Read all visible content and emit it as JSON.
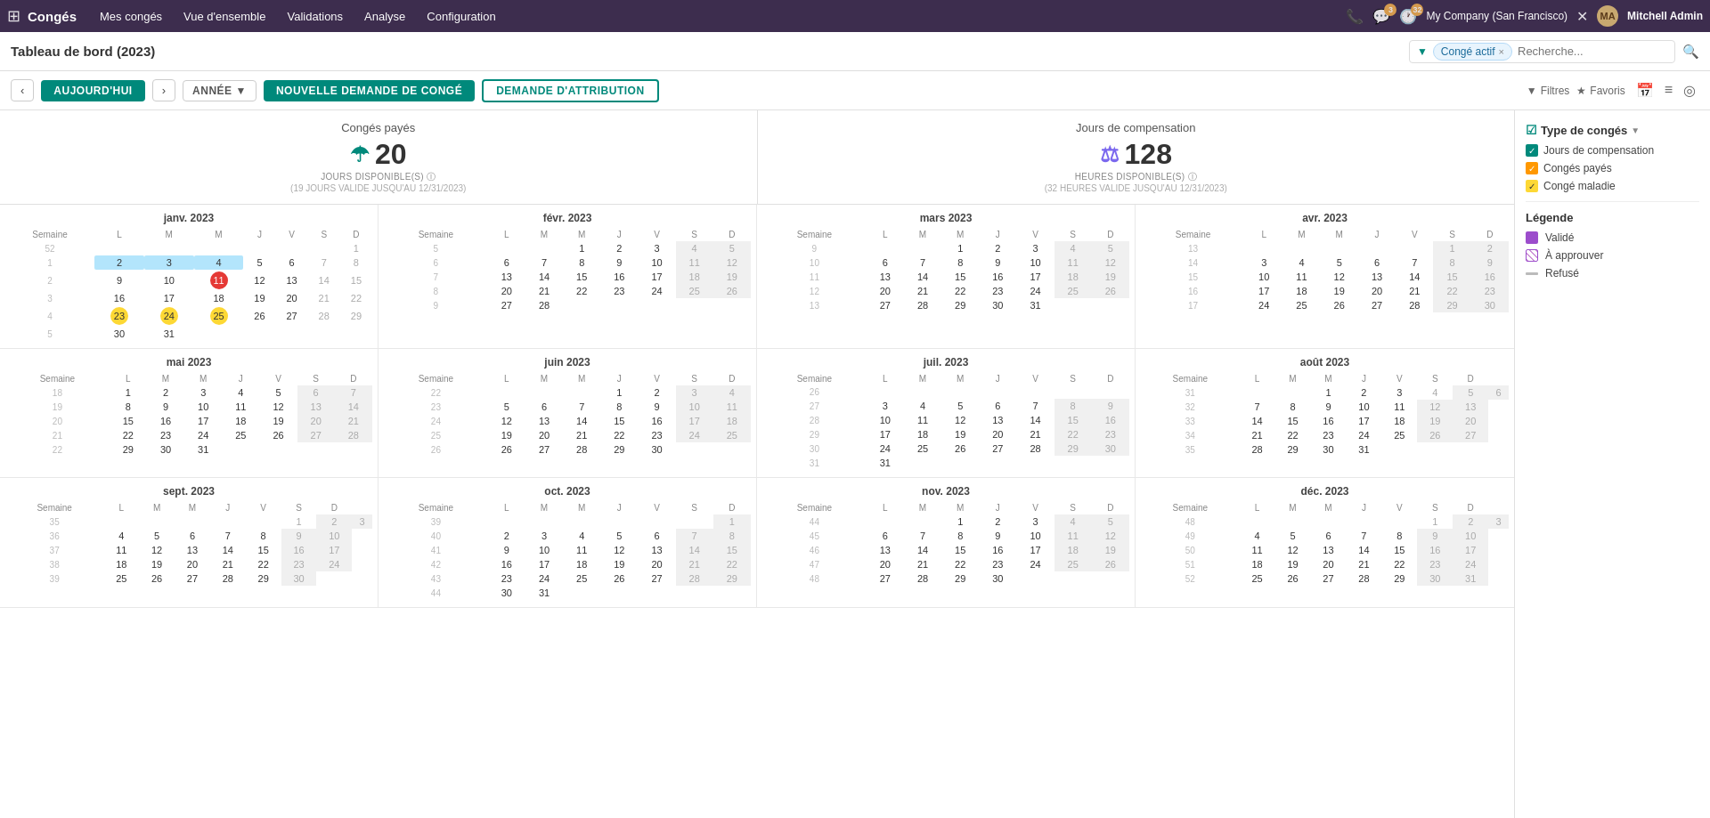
{
  "app": {
    "name": "Congés",
    "grid_icon": "⊞"
  },
  "nav": {
    "items": [
      {
        "label": "Mes congés",
        "active": false
      },
      {
        "label": "Vue d'ensemble",
        "active": false
      },
      {
        "label": "Validations",
        "active": false
      },
      {
        "label": "Analyse",
        "active": false
      },
      {
        "label": "Configuration",
        "active": false
      }
    ]
  },
  "topbar_right": {
    "phone_icon": "📞",
    "chat_badge": "3",
    "clock_badge": "32",
    "company": "My Company (San Francisco)",
    "user": "Mitchell Admin",
    "separator_icon": "✕"
  },
  "toolbar": {
    "page_title": "Tableau de bord (2023)",
    "filter_tag": "Congé actif",
    "search_placeholder": "Recherche...",
    "prev_label": "‹",
    "today_label": "AUJOURD'HUI",
    "next_label": "›",
    "year_label": "ANNÉE",
    "new_leave_label": "NOUVELLE DEMANDE DE CONGÉ",
    "allocation_label": "DEMANDE D'ATTRIBUTION",
    "filter_label": "Filtres",
    "fav_label": "Favoris"
  },
  "summary": {
    "left": {
      "title": "Congés payés",
      "icon": "☂",
      "number": "20",
      "subtitle": "JOURS DISPONIBLE(S) ⓘ",
      "subtext": "(19 JOURS VALIDE JUSQU'AU 12/31/2023)"
    },
    "right": {
      "title": "Jours de compensation",
      "icon": "⚖",
      "number": "128",
      "subtitle": "HEURES DISPONIBLE(S) ⓘ",
      "subtext": "(32 HEURES VALIDE JUSQU'AU 12/31/2023)"
    }
  },
  "right_panel": {
    "leave_type_title": "Type de congés",
    "types": [
      {
        "label": "Jours de compensation",
        "color": "teal"
      },
      {
        "label": "Congés payés",
        "color": "orange"
      },
      {
        "label": "Congé maladie",
        "color": "yellow"
      }
    ],
    "legend_title": "Légende",
    "legend": [
      {
        "type": "color",
        "color": "#9c4dcc",
        "label": "Validé"
      },
      {
        "type": "pattern",
        "label": "À approuver"
      },
      {
        "type": "line",
        "label": "Refusé"
      }
    ]
  },
  "months": [
    {
      "name": "janv. 2023",
      "year": 2023,
      "month": 1,
      "weeks": [
        {
          "num": "52",
          "days": [
            "",
            "",
            "",
            "",
            "",
            "",
            "1"
          ]
        },
        {
          "num": "1",
          "days": [
            "2",
            "3",
            "4",
            "5",
            "6",
            "7",
            "8"
          ]
        },
        {
          "num": "2",
          "days": [
            "9",
            "10",
            "11",
            "12",
            "13",
            "14",
            "15"
          ]
        },
        {
          "num": "3",
          "days": [
            "16",
            "17",
            "18",
            "19",
            "20",
            "21",
            "22"
          ]
        },
        {
          "num": "4",
          "days": [
            "23",
            "24",
            "25",
            "26",
            "27",
            "28",
            "29"
          ]
        },
        {
          "num": "5",
          "days": [
            "30",
            "31",
            "",
            "",
            "",
            "",
            ""
          ]
        }
      ],
      "highlights": {
        "range": [
          "2",
          "3",
          "4"
        ],
        "yellow_range": [
          "23",
          "24",
          "25"
        ],
        "today": "11"
      }
    },
    {
      "name": "févr. 2023",
      "year": 2023,
      "month": 2,
      "weeks": [
        {
          "num": "5",
          "days": [
            "",
            "",
            "1",
            "2",
            "3",
            "4",
            "5"
          ]
        },
        {
          "num": "6",
          "days": [
            "6",
            "7",
            "8",
            "9",
            "10",
            "11",
            "12"
          ]
        },
        {
          "num": "7",
          "days": [
            "13",
            "14",
            "15",
            "16",
            "17",
            "18",
            "19"
          ]
        },
        {
          "num": "8",
          "days": [
            "20",
            "21",
            "22",
            "23",
            "24",
            "25",
            "26"
          ]
        },
        {
          "num": "9",
          "days": [
            "27",
            "28",
            "",
            "",
            "",
            "",
            ""
          ]
        }
      ],
      "highlights": {
        "gray": [
          "4",
          "5",
          "11",
          "12",
          "18",
          "19",
          "25",
          "26"
        ]
      }
    },
    {
      "name": "mars 2023",
      "year": 2023,
      "month": 3,
      "weeks": [
        {
          "num": "9",
          "days": [
            "",
            "",
            "1",
            "2",
            "3",
            "4",
            "5"
          ]
        },
        {
          "num": "10",
          "days": [
            "6",
            "7",
            "8",
            "9",
            "10",
            "11",
            "12"
          ]
        },
        {
          "num": "11",
          "days": [
            "13",
            "14",
            "15",
            "16",
            "17",
            "18",
            "19"
          ]
        },
        {
          "num": "12",
          "days": [
            "20",
            "21",
            "22",
            "23",
            "24",
            "25",
            "26"
          ]
        },
        {
          "num": "13",
          "days": [
            "27",
            "28",
            "29",
            "30",
            "31",
            "",
            ""
          ]
        }
      ],
      "highlights": {
        "gray": [
          "4",
          "5",
          "11",
          "12",
          "18",
          "19",
          "25",
          "26"
        ]
      }
    },
    {
      "name": "avr. 2023",
      "year": 2023,
      "month": 4,
      "weeks": [
        {
          "num": "13",
          "days": [
            "",
            "",
            "",
            "",
            "",
            "1",
            "2"
          ]
        },
        {
          "num": "14",
          "days": [
            "3",
            "4",
            "5",
            "6",
            "7",
            "8",
            "9"
          ]
        },
        {
          "num": "15",
          "days": [
            "10",
            "11",
            "12",
            "13",
            "14",
            "15",
            "16"
          ]
        },
        {
          "num": "16",
          "days": [
            "17",
            "18",
            "19",
            "20",
            "21",
            "22",
            "23"
          ]
        },
        {
          "num": "17",
          "days": [
            "24",
            "25",
            "26",
            "27",
            "28",
            "29",
            "30"
          ]
        }
      ],
      "highlights": {
        "gray": [
          "1",
          "2",
          "8",
          "9",
          "15",
          "16",
          "22",
          "23",
          "29",
          "30"
        ]
      }
    },
    {
      "name": "mai 2023",
      "year": 2023,
      "month": 5,
      "weeks": [
        {
          "num": "18",
          "days": [
            "1",
            "2",
            "3",
            "4",
            "5",
            "6",
            "7"
          ]
        },
        {
          "num": "19",
          "days": [
            "8",
            "9",
            "10",
            "11",
            "12",
            "13",
            "14"
          ]
        },
        {
          "num": "20",
          "days": [
            "15",
            "16",
            "17",
            "18",
            "19",
            "20",
            "21"
          ]
        },
        {
          "num": "21",
          "days": [
            "22",
            "23",
            "24",
            "25",
            "26",
            "27",
            "28"
          ]
        },
        {
          "num": "22",
          "days": [
            "29",
            "30",
            "31",
            "",
            "",
            "",
            ""
          ]
        }
      ],
      "highlights": {
        "gray": [
          "6",
          "7",
          "13",
          "14",
          "20",
          "21",
          "27",
          "28"
        ]
      }
    },
    {
      "name": "juin 2023",
      "year": 2023,
      "month": 6,
      "weeks": [
        {
          "num": "22",
          "days": [
            "",
            "",
            "",
            "1",
            "2",
            "3",
            "4"
          ]
        },
        {
          "num": "23",
          "days": [
            "5",
            "6",
            "7",
            "8",
            "9",
            "10",
            "11"
          ]
        },
        {
          "num": "24",
          "days": [
            "12",
            "13",
            "14",
            "15",
            "16",
            "17",
            "18"
          ]
        },
        {
          "num": "25",
          "days": [
            "19",
            "20",
            "21",
            "22",
            "23",
            "24",
            "25"
          ]
        },
        {
          "num": "26",
          "days": [
            "26",
            "27",
            "28",
            "29",
            "30",
            "",
            ""
          ]
        }
      ],
      "highlights": {
        "gray": [
          "3",
          "4",
          "10",
          "11",
          "17",
          "18",
          "24",
          "25"
        ]
      }
    },
    {
      "name": "juil. 2023",
      "year": 2023,
      "month": 7,
      "weeks": [
        {
          "num": "26",
          "days": [
            "",
            "",
            "",
            "",
            "",
            "",
            ""
          ]
        },
        {
          "num": "27",
          "days": [
            "3",
            "4",
            "5",
            "6",
            "7",
            "8",
            "9"
          ]
        },
        {
          "num": "28",
          "days": [
            "10",
            "11",
            "12",
            "13",
            "14",
            "15",
            "16"
          ]
        },
        {
          "num": "29",
          "days": [
            "17",
            "18",
            "19",
            "20",
            "21",
            "22",
            "23"
          ]
        },
        {
          "num": "30",
          "days": [
            "24",
            "25",
            "26",
            "27",
            "28",
            "29",
            "30"
          ]
        },
        {
          "num": "31",
          "days": [
            "31",
            "",
            "",
            "",
            "",
            "",
            ""
          ]
        }
      ],
      "highlights": {
        "gray": [
          "1",
          "2",
          "8",
          "9",
          "15",
          "16",
          "22",
          "23",
          "29",
          "30"
        ]
      }
    },
    {
      "name": "août 2023",
      "year": 2023,
      "month": 8,
      "weeks": [
        {
          "num": "31",
          "days": [
            "",
            "",
            "1",
            "2",
            "3",
            "4",
            "5",
            "6"
          ]
        },
        {
          "num": "32",
          "days": [
            "7",
            "8",
            "9",
            "10",
            "11",
            "12",
            "13"
          ]
        },
        {
          "num": "33",
          "days": [
            "14",
            "15",
            "16",
            "17",
            "18",
            "19",
            "20"
          ]
        },
        {
          "num": "34",
          "days": [
            "21",
            "22",
            "23",
            "24",
            "25",
            "26",
            "27"
          ]
        },
        {
          "num": "35",
          "days": [
            "28",
            "29",
            "30",
            "31",
            "",
            "",
            ""
          ]
        }
      ],
      "highlights": {
        "gray": [
          "5",
          "6",
          "12",
          "13",
          "19",
          "20",
          "26",
          "27"
        ]
      }
    },
    {
      "name": "sept. 2023",
      "year": 2023,
      "month": 9,
      "weeks": [
        {
          "num": "35",
          "days": [
            "",
            "",
            "",
            "",
            "",
            "1",
            "2",
            "3"
          ]
        },
        {
          "num": "36",
          "days": [
            "4",
            "5",
            "6",
            "7",
            "8",
            "9",
            "10"
          ]
        },
        {
          "num": "37",
          "days": [
            "11",
            "12",
            "13",
            "14",
            "15",
            "16",
            "17"
          ]
        },
        {
          "num": "38",
          "days": [
            "18",
            "19",
            "20",
            "21",
            "22",
            "23",
            "24"
          ]
        },
        {
          "num": "39",
          "days": [
            "25",
            "26",
            "27",
            "28",
            "29",
            "30",
            ""
          ]
        }
      ],
      "highlights": {
        "gray": [
          "2",
          "3",
          "9",
          "10",
          "16",
          "17",
          "23",
          "24",
          "30"
        ]
      }
    },
    {
      "name": "oct. 2023",
      "year": 2023,
      "month": 10,
      "weeks": [
        {
          "num": "39",
          "days": [
            "",
            "",
            "",
            "",
            "",
            "",
            "1"
          ]
        },
        {
          "num": "40",
          "days": [
            "2",
            "3",
            "4",
            "5",
            "6",
            "7",
            "8"
          ]
        },
        {
          "num": "41",
          "days": [
            "9",
            "10",
            "11",
            "12",
            "13",
            "14",
            "15"
          ]
        },
        {
          "num": "42",
          "days": [
            "16",
            "17",
            "18",
            "19",
            "20",
            "21",
            "22"
          ]
        },
        {
          "num": "43",
          "days": [
            "23",
            "24",
            "25",
            "26",
            "27",
            "28",
            "29"
          ]
        },
        {
          "num": "44",
          "days": [
            "30",
            "31",
            "",
            "",
            "",
            "",
            ""
          ]
        }
      ],
      "highlights": {
        "gray": [
          "1",
          "7",
          "8",
          "14",
          "15",
          "21",
          "22",
          "28",
          "29"
        ]
      }
    },
    {
      "name": "nov. 2023",
      "year": 2023,
      "month": 11,
      "weeks": [
        {
          "num": "44",
          "days": [
            "",
            "",
            "1",
            "2",
            "3",
            "4",
            "5"
          ]
        },
        {
          "num": "45",
          "days": [
            "6",
            "7",
            "8",
            "9",
            "10",
            "11",
            "12"
          ]
        },
        {
          "num": "46",
          "days": [
            "13",
            "14",
            "15",
            "16",
            "17",
            "18",
            "19"
          ]
        },
        {
          "num": "47",
          "days": [
            "20",
            "21",
            "22",
            "23",
            "24",
            "25",
            "26"
          ]
        },
        {
          "num": "48",
          "days": [
            "27",
            "28",
            "29",
            "30",
            "",
            "",
            ""
          ]
        }
      ],
      "highlights": {
        "gray": [
          "4",
          "5",
          "11",
          "12",
          "18",
          "19",
          "25",
          "26"
        ]
      }
    },
    {
      "name": "déc. 2023",
      "year": 2023,
      "month": 12,
      "weeks": [
        {
          "num": "48",
          "days": [
            "",
            "",
            "",
            "",
            "",
            "1",
            "2",
            "3"
          ]
        },
        {
          "num": "49",
          "days": [
            "4",
            "5",
            "6",
            "7",
            "8",
            "9",
            "10"
          ]
        },
        {
          "num": "50",
          "days": [
            "11",
            "12",
            "13",
            "14",
            "15",
            "16",
            "17"
          ]
        },
        {
          "num": "51",
          "days": [
            "18",
            "19",
            "20",
            "21",
            "22",
            "23",
            "24"
          ]
        },
        {
          "num": "52",
          "days": [
            "25",
            "26",
            "27",
            "28",
            "29",
            "30",
            "31"
          ]
        }
      ],
      "highlights": {
        "gray": [
          "2",
          "3",
          "9",
          "10",
          "16",
          "17",
          "23",
          "24",
          "30",
          "31"
        ]
      }
    }
  ]
}
